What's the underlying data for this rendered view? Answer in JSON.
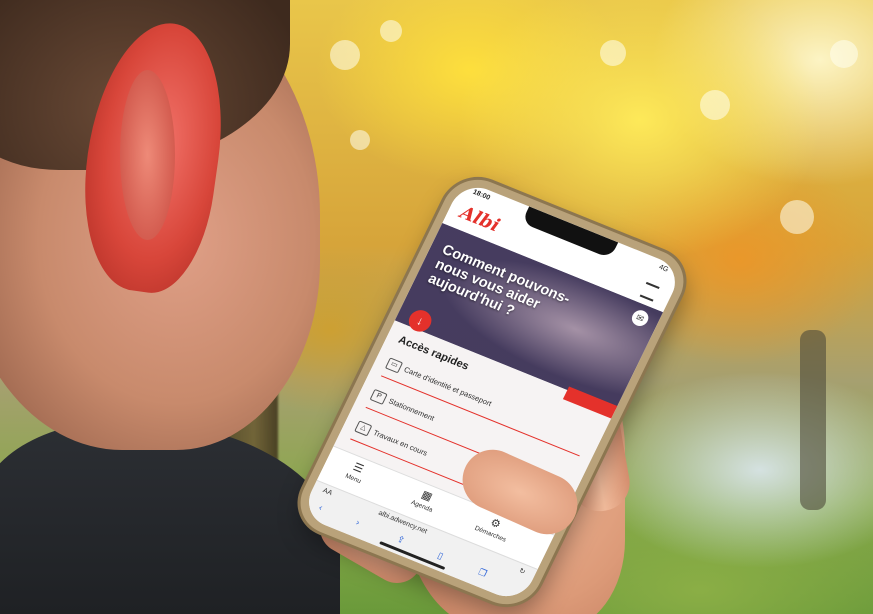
{
  "status_bar": {
    "time": "18:00",
    "signal": "4G"
  },
  "app": {
    "logo_text": "Albi",
    "hero_title": "Comment pouvons-nous vous aider aujourd'hui ?",
    "quick_access": {
      "heading": "Accès rapides",
      "items": [
        {
          "label": "Carte d'identité et passeport",
          "icon": "id-card-icon"
        },
        {
          "label": "Stationnement",
          "icon": "parking-icon"
        },
        {
          "label": "Travaux en cours",
          "icon": "roadwork-icon"
        }
      ]
    },
    "tabbar": {
      "tabs": [
        {
          "label": "Menu",
          "icon": "menu-icon"
        },
        {
          "label": "Agenda",
          "icon": "calendar-icon"
        },
        {
          "label": "Démarches",
          "icon": "procedures-icon"
        }
      ]
    }
  },
  "browser": {
    "text_size_label": "AA",
    "url": "albi.adwency.net"
  },
  "colors": {
    "brand_red": "#e4312b"
  }
}
